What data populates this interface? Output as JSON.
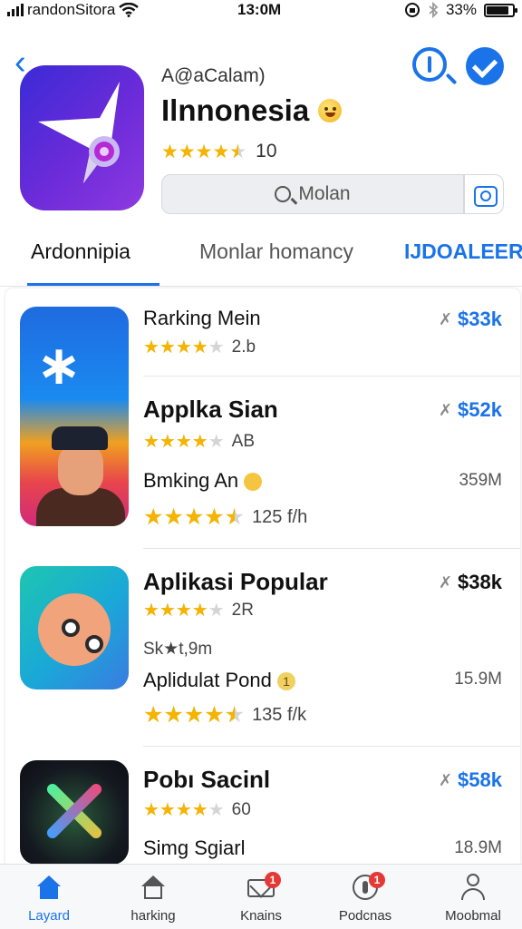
{
  "status_bar": {
    "carrier": "randonSitora",
    "time": "13:0M",
    "battery": "33%",
    "battery_level": 0.85
  },
  "app_header": {
    "subtitle": "A@aCalam)",
    "title": "Ilnnonesia",
    "rating_value": 4.5,
    "rating_count": "10",
    "search_placeholder": "Molan"
  },
  "tabs": [
    {
      "label": "Ardonnipia",
      "active": true
    },
    {
      "label": "Monlar homancy",
      "active": false
    },
    {
      "label": "IJDOALEER",
      "active": false
    }
  ],
  "list": [
    {
      "title": "Rarking Mein",
      "rating": 4,
      "meta": "2.b",
      "price": "$33k"
    },
    {
      "title": "Applka Sian",
      "rating": 4,
      "meta": "AB",
      "price": "$52k"
    },
    {
      "title": "Bmking An",
      "rating": 4.5,
      "meta": "125 f/h",
      "size": "359M"
    },
    {
      "title": "Aplikasi Popular",
      "rating": 4,
      "meta": "2R",
      "price": "$38k",
      "note": "Sk★t,9m"
    },
    {
      "title": "Aplidulat Pond",
      "rating": 4.5,
      "meta": "135 f/k",
      "size": "15.9M",
      "badge": "1"
    },
    {
      "title": "Pobı Sacinl",
      "rating": 4,
      "meta": "60",
      "price": "$58k"
    },
    {
      "title": "Simg Sgiarl",
      "size": "18.9M"
    }
  ],
  "bottom_nav": [
    {
      "label": "Layard",
      "icon": "home-icon",
      "active": true
    },
    {
      "label": "harking",
      "icon": "house-outline-icon",
      "active": false
    },
    {
      "label": "Knains",
      "icon": "mail-icon",
      "active": false,
      "badge": "1"
    },
    {
      "label": "Podcnas",
      "icon": "podcast-icon",
      "active": false,
      "badge": "1"
    },
    {
      "label": "Moobmal",
      "icon": "person-icon",
      "active": false
    }
  ],
  "colors": {
    "accent": "#1a73e8",
    "star": "#f4b400"
  }
}
